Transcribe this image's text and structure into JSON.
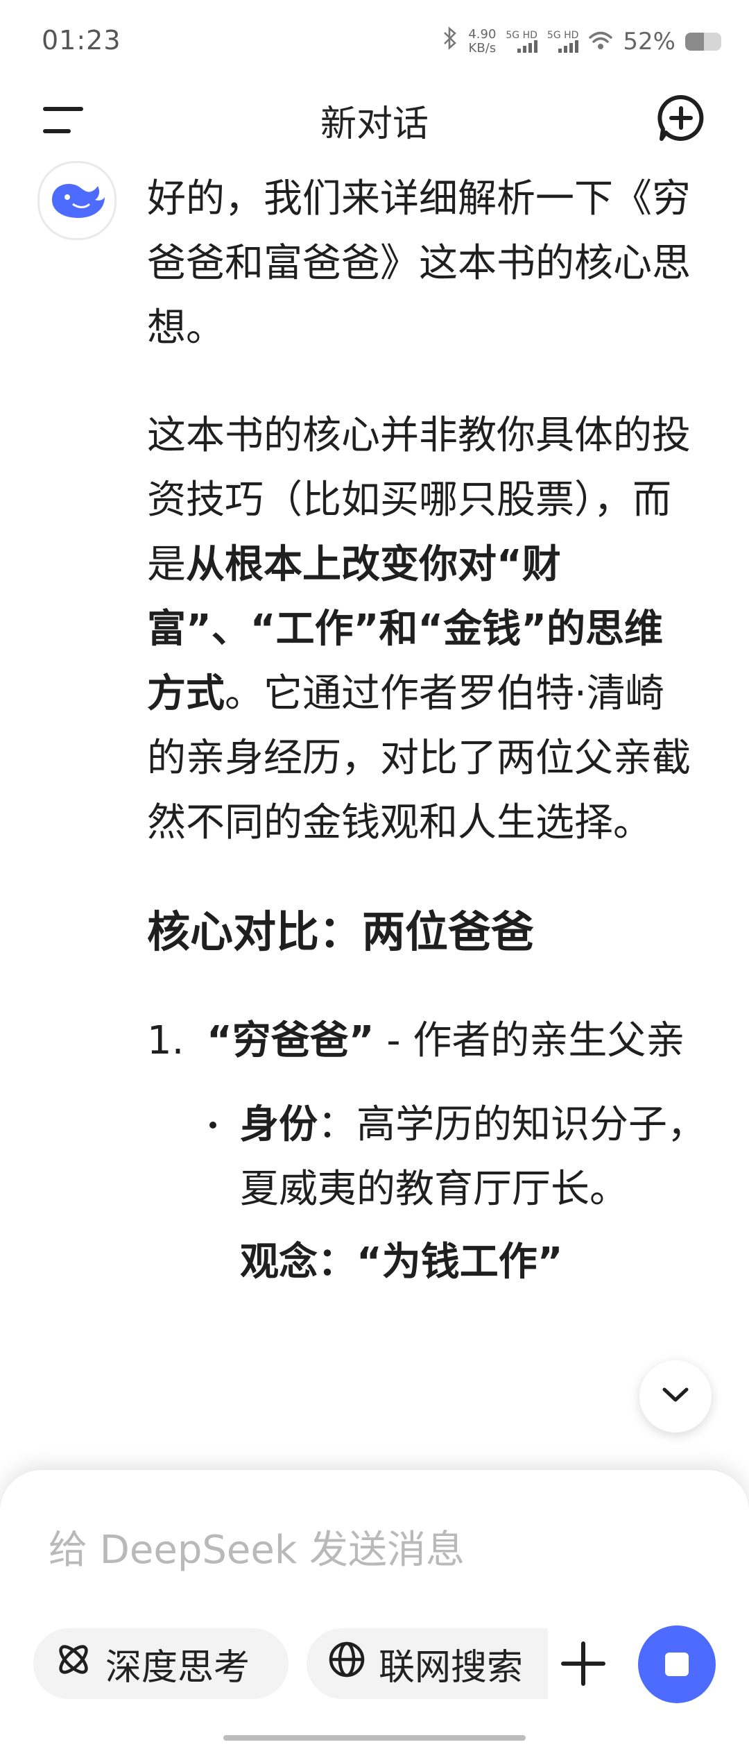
{
  "status_bar": {
    "time": "01:23",
    "net_speed_value": "4.90",
    "net_speed_unit": "KB/s",
    "sim1_label": "5G HD",
    "sim2_label": "5G HD",
    "battery_percent": "52%",
    "battery_level": 0.52
  },
  "header": {
    "title": "新对话"
  },
  "message": {
    "para1": "好的，我们来详细解析一下《穷爸爸和富爸爸》这本书的核心思想。",
    "para2_a": "这本书的核心并非教你具体的投资技巧（比如买哪只股票），而是",
    "para2_bold": "从根本上改变你对“财富”、“工作”和“金钱”的思维方式",
    "para2_b": "。它通过作者罗伯特·清崎的亲身经历，对比了两位父亲截然不同的金钱观和人生选择。",
    "heading": "核心对比：两位爸爸",
    "item1_num": "1.",
    "item1_bold": "“穷爸爸”",
    "item1_rest": " - 作者的亲生父亲",
    "sub1_bold": "身份",
    "sub1_rest": "：高学历的知识分子，夏威夷的教育厅厅长。",
    "sub2_partial": "观念：“为钱工作”"
  },
  "input": {
    "placeholder": "给 DeepSeek 发送消息",
    "deep_think_label": "深度思考",
    "web_search_label": "联网搜索"
  },
  "colors": {
    "accent": "#4d6bfe"
  }
}
